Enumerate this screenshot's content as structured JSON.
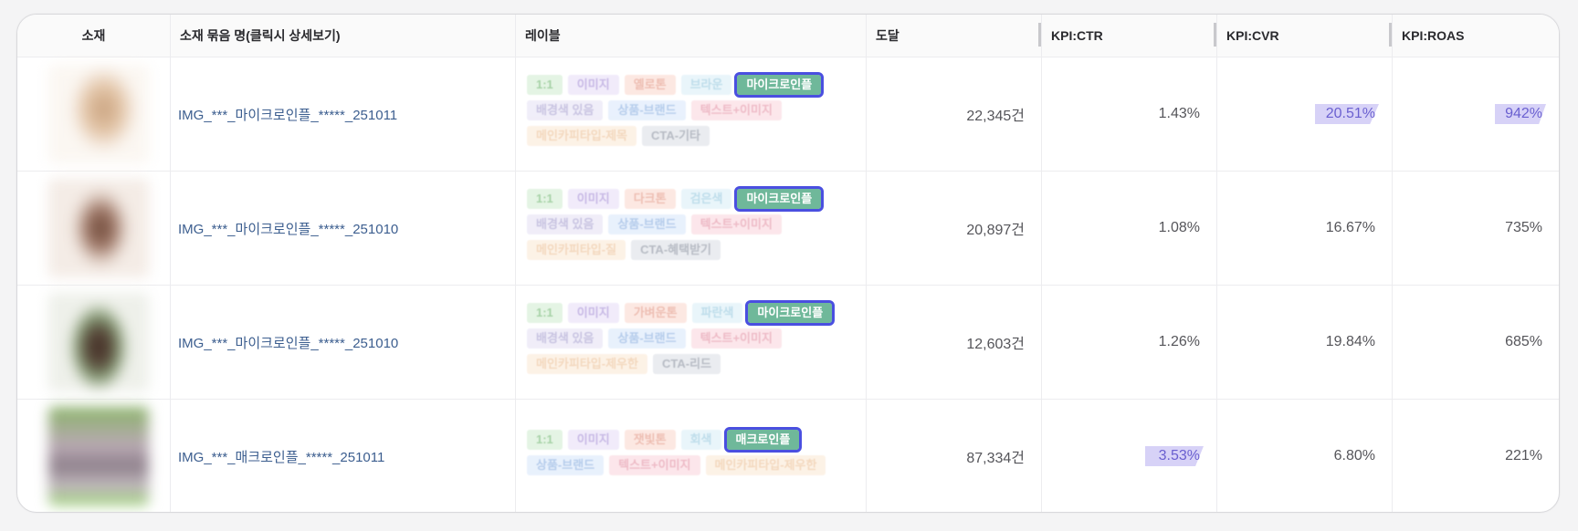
{
  "columns": [
    "소재",
    "소재 묶음 명(클릭시 상세보기)",
    "레이블",
    "도달",
    "KPI:CTR",
    "KPI:CVR",
    "KPI:ROAS"
  ],
  "rows": [
    {
      "name": "IMG_***_마이크로인플_*****_251011",
      "tags": [
        "1:1",
        "이미지",
        "옐로톤",
        "브라운",
        "마이크로인플",
        "배경색 있음",
        "상품-브랜드",
        "텍스트+이미지",
        "메인카피타입-제목",
        "CTA-기타"
      ],
      "reach": "22,345건",
      "ctr": "1.43%",
      "cvr": "20.51%",
      "roas": "942%",
      "ctr_hl": false,
      "cvr_hl": true,
      "roas_hl": true
    },
    {
      "name": "IMG_***_마이크로인플_*****_251010",
      "tags": [
        "1:1",
        "이미지",
        "다크톤",
        "검은색",
        "마이크로인플",
        "배경색 있음",
        "상품-브랜드",
        "텍스트+이미지",
        "메인카피타입-질",
        "CTA-혜택받기"
      ],
      "reach": "20,897건",
      "ctr": "1.08%",
      "cvr": "16.67%",
      "roas": "735%",
      "ctr_hl": false,
      "cvr_hl": false,
      "roas_hl": false
    },
    {
      "name": "IMG_***_마이크로인플_*****_251010",
      "tags": [
        "1:1",
        "이미지",
        "가벼운톤",
        "파란색",
        "마이크로인플",
        "배경색 있음",
        "상품-브랜드",
        "텍스트+이미지",
        "메인카피타입-제우한",
        "CTA-리드"
      ],
      "reach": "12,603건",
      "ctr": "1.26%",
      "cvr": "19.84%",
      "roas": "685%",
      "ctr_hl": false,
      "cvr_hl": false,
      "roas_hl": false
    },
    {
      "name": "IMG_***_매크로인플_*****_251011",
      "tags": [
        "1:1",
        "이미지",
        "잿빛톤",
        "회색",
        "매크로인플",
        "상품-브랜드",
        "텍스트+이미지",
        "메인카피타입-제우한"
      ],
      "reach": "87,334건",
      "ctr": "3.53%",
      "cvr": "6.80%",
      "roas": "221%",
      "ctr_hl": true,
      "cvr_hl": false,
      "roas_hl": false
    }
  ],
  "colors": {
    "link": "#3c5e8f",
    "highlight_tag_bg": "#6fb89a",
    "highlight_tag_border": "#4a4fe0",
    "kpi_highlight_bg": "#d7d2f7"
  }
}
